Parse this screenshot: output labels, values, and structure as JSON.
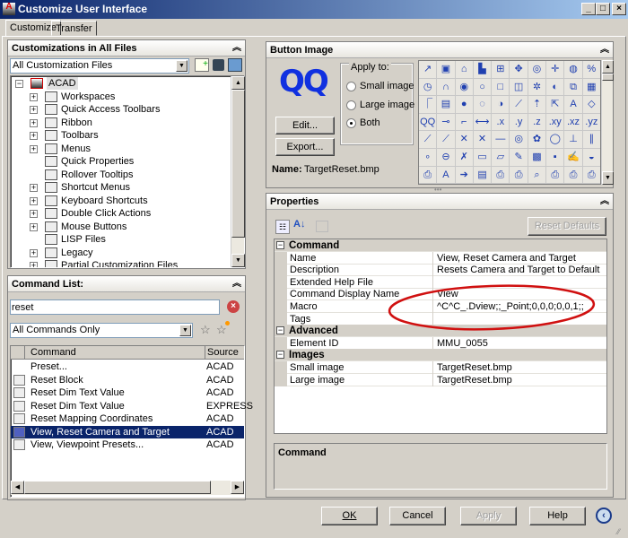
{
  "window": {
    "title": "Customize User Interface",
    "min": "_",
    "max": "□",
    "close": "×"
  },
  "tabs": [
    {
      "label": "Customize",
      "active": true
    },
    {
      "label": "Transfer",
      "active": false
    }
  ],
  "customizations": {
    "title": "Customizations in All Files",
    "file_select": "All Customization Files",
    "tree": [
      {
        "label": "ACAD",
        "expander": "−",
        "level": 0
      },
      {
        "label": "Workspaces",
        "expander": "+",
        "level": 1
      },
      {
        "label": "Quick Access Toolbars",
        "expander": "+",
        "level": 1
      },
      {
        "label": "Ribbon",
        "expander": "+",
        "level": 1
      },
      {
        "label": "Toolbars",
        "expander": "+",
        "level": 1
      },
      {
        "label": "Menus",
        "expander": "+",
        "level": 1
      },
      {
        "label": "Quick Properties",
        "expander": "",
        "level": 1
      },
      {
        "label": "Rollover Tooltips",
        "expander": "",
        "level": 1
      },
      {
        "label": "Shortcut Menus",
        "expander": "+",
        "level": 1
      },
      {
        "label": "Keyboard Shortcuts",
        "expander": "+",
        "level": 1
      },
      {
        "label": "Double Click Actions",
        "expander": "+",
        "level": 1
      },
      {
        "label": "Mouse Buttons",
        "expander": "+",
        "level": 1
      },
      {
        "label": "LISP Files",
        "expander": "",
        "level": 1
      },
      {
        "label": "Legacy",
        "expander": "+",
        "level": 1
      },
      {
        "label": "Partial Customization Files",
        "expander": "+",
        "level": 1
      }
    ]
  },
  "command_list": {
    "title": "Command List:",
    "search_value": "reset",
    "filter": "All Commands Only",
    "columns": [
      "Command",
      "Source"
    ],
    "rows": [
      {
        "command": "Preset...",
        "source": "ACAD",
        "selected": false
      },
      {
        "command": "Reset Block",
        "source": "ACAD",
        "selected": false
      },
      {
        "command": "Reset Dim Text Value",
        "source": "ACAD",
        "selected": false
      },
      {
        "command": "Reset Dim Text Value",
        "source": "EXPRESS",
        "selected": false
      },
      {
        "command": "Reset Mapping Coordinates",
        "source": "ACAD",
        "selected": false
      },
      {
        "command": "View, Reset Camera and Target",
        "source": "ACAD",
        "selected": true
      },
      {
        "command": "View, Viewpoint Presets...",
        "source": "ACAD",
        "selected": false
      }
    ]
  },
  "button_image": {
    "title": "Button Image",
    "preview": "QQ",
    "apply_to": "Apply to:",
    "options": [
      {
        "label": "Small image",
        "checked": false
      },
      {
        "label": "Large image",
        "checked": false
      },
      {
        "label": "Both",
        "checked": true
      }
    ],
    "edit": "Edit...",
    "export": "Export...",
    "name_label": "Name:",
    "name_value": "TargetReset.bmp",
    "icons": [
      "↗",
      "▣",
      "⌂",
      "▙",
      "⊞",
      "✥",
      "◎",
      "✛",
      "◍",
      "%",
      "◷",
      "∩",
      "◉",
      "○",
      "□",
      "◫",
      "✲",
      "◐",
      "⧉",
      "▦",
      "⎾",
      "▤",
      "●",
      "◌",
      "◑",
      "⟋",
      "⇡",
      "⇱",
      "A",
      "◇",
      "QQ",
      "⊸",
      "⌐",
      "⟷",
      ".x",
      ".y",
      ".z",
      ".xy",
      ".xz",
      ".yz",
      "⟋",
      "⟋",
      "✕",
      "✕",
      "—",
      "◎",
      "✿",
      "◯",
      "⊥",
      "∥",
      "∘",
      "⊖",
      "✗",
      "▭",
      "▱",
      "✎",
      "▩",
      "▪",
      "✍",
      "◒",
      "⎙",
      "A",
      "➔",
      "▤",
      "⎙",
      "⎙",
      "⌕",
      "⎙",
      "⎙",
      "⎙"
    ]
  },
  "properties": {
    "title": "Properties",
    "reset_defaults": "Reset Defaults",
    "categories": [
      {
        "name": "Command",
        "expander": "−",
        "rows": [
          {
            "key": "Name",
            "value": "View, Reset Camera and Target"
          },
          {
            "key": "Description",
            "value": "Resets Camera and Target to Default"
          },
          {
            "key": "Extended Help File",
            "value": ""
          },
          {
            "key": "Command Display Name",
            "value": "View"
          },
          {
            "key": "Macro",
            "value": "^C^C_.Dview;;_Point;0,0,0;0,0,1;;"
          },
          {
            "key": "Tags",
            "value": ""
          }
        ]
      },
      {
        "name": "Advanced",
        "expander": "−",
        "rows": [
          {
            "key": "Element ID",
            "value": "MMU_0055"
          }
        ]
      },
      {
        "name": "Images",
        "expander": "−",
        "rows": [
          {
            "key": "Small image",
            "value": "TargetReset.bmp"
          },
          {
            "key": "Large image",
            "value": "TargetReset.bmp"
          }
        ]
      }
    ],
    "description_title": "Command"
  },
  "footer": {
    "ok": "OK",
    "cancel": "Cancel",
    "apply": "Apply",
    "help": "Help"
  },
  "colors": {
    "title_start": "#0a246a",
    "selection": "#0a246a",
    "annotation": "#d01010"
  }
}
